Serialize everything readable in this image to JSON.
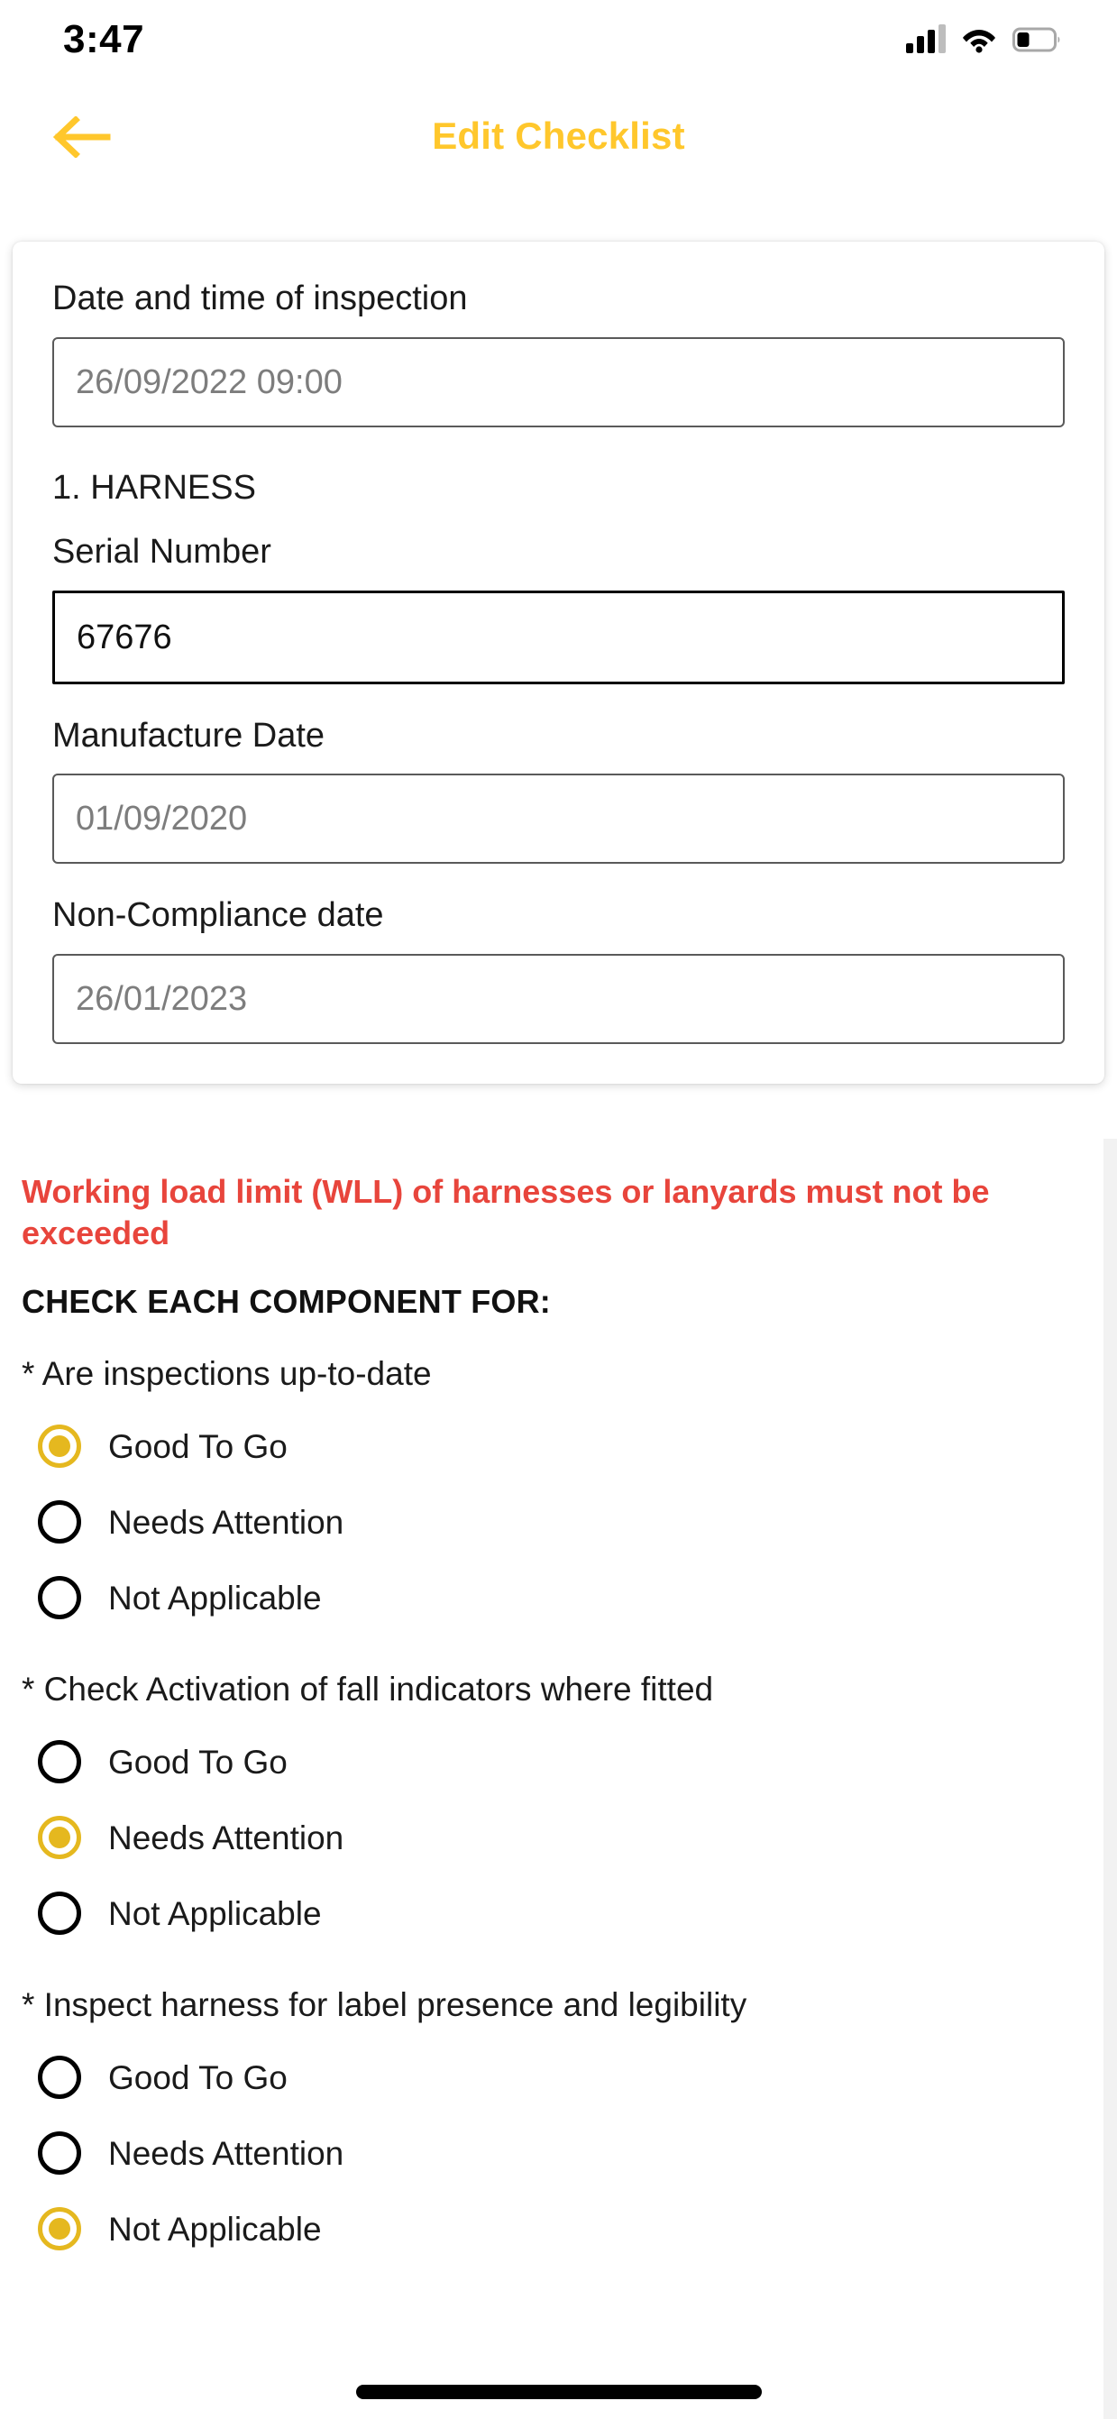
{
  "status_bar": {
    "time": "3:47",
    "signal_icon": "cellular-signal-icon",
    "wifi_icon": "wifi-icon",
    "battery_icon": "battery-icon"
  },
  "header": {
    "back_icon": "back-arrow-icon",
    "title": "Edit Checklist",
    "accent_color": "#FFC72C"
  },
  "form": {
    "fields": [
      {
        "label": "Date and time of inspection",
        "value": "",
        "placeholder": "26/09/2022 09:00",
        "focused": false
      },
      {
        "label": "Serial Number",
        "value": "67676",
        "placeholder": "",
        "focused": true
      },
      {
        "label": "Manufacture Date",
        "value": "",
        "placeholder": "01/09/2020",
        "focused": false
      },
      {
        "label": "Non-Compliance date",
        "value": "",
        "placeholder": "26/01/2023",
        "focused": false
      }
    ],
    "section_heading": "1. HARNESS"
  },
  "notice": {
    "warning": "Working load limit (WLL) of harnesses or lanyards must not be exceeded",
    "warning_color": "#E8453C",
    "check_heading": "CHECK EACH COMPONENT FOR:"
  },
  "radio_accent_color": "#E5B81F",
  "questions": [
    {
      "text": "* Are inspections up-to-date",
      "options": [
        {
          "label": "Good To Go",
          "selected": true
        },
        {
          "label": "Needs Attention",
          "selected": false
        },
        {
          "label": "Not Applicable",
          "selected": false
        }
      ]
    },
    {
      "text": "* Check Activation of fall indicators where fitted",
      "options": [
        {
          "label": "Good To Go",
          "selected": false
        },
        {
          "label": "Needs Attention",
          "selected": true
        },
        {
          "label": "Not Applicable",
          "selected": false
        }
      ]
    },
    {
      "text": "* Inspect harness for label presence and legibility",
      "options": [
        {
          "label": "Good To Go",
          "selected": false
        },
        {
          "label": "Needs Attention",
          "selected": false
        },
        {
          "label": "Not Applicable",
          "selected": true
        }
      ]
    }
  ]
}
